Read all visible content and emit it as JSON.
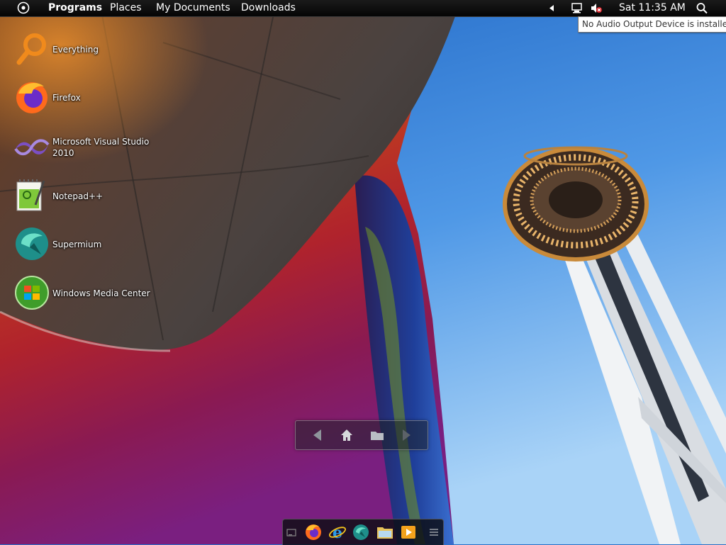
{
  "top_panel": {
    "menu": [
      "Programs",
      "Places",
      "My Documents",
      "Downloads"
    ],
    "clock": "Sat 11:35 AM",
    "icons": {
      "start": "circle-dot-start-icon",
      "tray_expand": "triangle-left-icon",
      "network": "network-monitor-icon",
      "volume": "speaker-muted-icon",
      "search": "search-icon"
    }
  },
  "tooltip": {
    "text": "No Audio Output Device is installed."
  },
  "desktop_icons": [
    {
      "label": "Everything",
      "icon": "magnifier-icon"
    },
    {
      "label": "Firefox",
      "icon": "firefox-icon"
    },
    {
      "label": "Microsoft Visual Studio 2010",
      "icon": "visual-studio-icon"
    },
    {
      "label": "Notepad++",
      "icon": "notepad-plus-plus-icon"
    },
    {
      "label": "Supermium",
      "icon": "supermium-icon"
    },
    {
      "label": "Windows Media Center",
      "icon": "windows-media-center-icon"
    }
  ],
  "navbar": {
    "icons": [
      "back-arrow-icon",
      "home-icon",
      "folder-icon",
      "forward-arrow-icon"
    ]
  },
  "dock": {
    "items": [
      "show-desktop-icon",
      "firefox-icon",
      "internet-explorer-icon",
      "supermium-icon",
      "file-explorer-icon",
      "media-player-icon",
      "menu-lines-icon"
    ]
  },
  "colors": {
    "panel": "#0b0b0b",
    "sky": "#2f7fd6",
    "tower": "#f2f2f2",
    "saucer": "#c98a3a"
  }
}
